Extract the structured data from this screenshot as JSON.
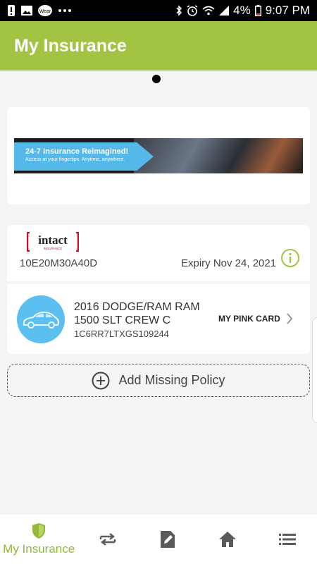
{
  "status_bar": {
    "time": "9:07 PM",
    "battery": "4%",
    "left_icons": [
      "alert-icon",
      "image-icon",
      "app-badge-icon",
      "more-dots-icon"
    ],
    "right_icons": [
      "bluetooth-icon",
      "alarm-icon",
      "wifi-icon",
      "signal-icon",
      "battery-icon"
    ],
    "app_badge_text": "Wear"
  },
  "app_bar": {
    "title": "My Insurance",
    "color": "#a3c443"
  },
  "pager": {
    "pages": 1,
    "current": 1
  },
  "banner": {
    "title": "24-7 Insurance Reimagined!",
    "subtitle": "Access at your fingertips. Anytime, anywhere.",
    "accent": "#54b9e9"
  },
  "policy": {
    "brand": "intact",
    "brand_sub": "INSURANCE",
    "number": "10E20M30A40D",
    "expiry": "Expiry Nov 24, 2021"
  },
  "vehicle": {
    "name": "2016 DODGE/RAM RAM 1500 SLT CREW C",
    "vin": "1C6RR7LTXGS109244",
    "action": "MY PINK CARD"
  },
  "add_policy": {
    "label": "Add Missing Policy"
  },
  "bottom_nav": {
    "items": [
      {
        "label": "My Insurance",
        "icon": "shield-icon",
        "active": true
      },
      {
        "label": "",
        "icon": "transfer-icon",
        "active": false
      },
      {
        "label": "",
        "icon": "edit-document-icon",
        "active": false
      },
      {
        "label": "",
        "icon": "home-icon",
        "active": false
      },
      {
        "label": "",
        "icon": "menu-list-icon",
        "active": false
      }
    ],
    "active_color": "#93b83a",
    "inactive_color": "#5a5a5a"
  }
}
